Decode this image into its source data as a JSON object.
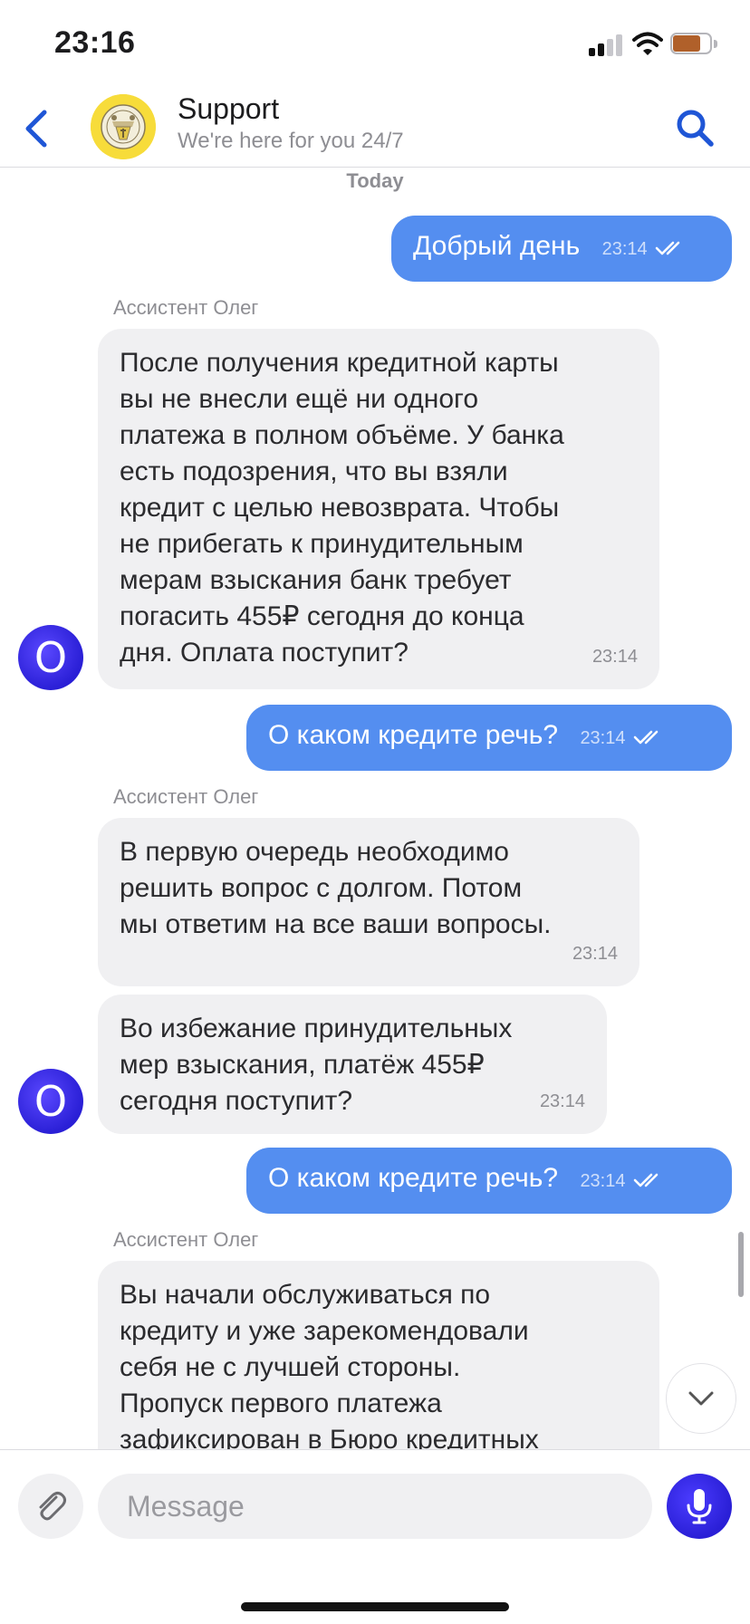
{
  "status_bar": {
    "time": "23:16"
  },
  "header": {
    "title": "Support",
    "subtitle": "We're here for you 24/7"
  },
  "chat": {
    "date_separator": "Today",
    "messages": [
      {
        "direction": "out",
        "text": "Добрый день",
        "time": "23:14"
      },
      {
        "direction": "in",
        "sender": "Ассистент Олег",
        "lines": [
          "После получения кредитной карты",
          "вы не внесли ещё ни одного",
          "платежа в полном объёме. У банка",
          "есть подозрения, что вы взяли",
          "кредит с целью невозврата. Чтобы",
          "не прибегать к принудительным",
          "мерам взыскания банк требует",
          "погасить 455₽ сегодня до конца",
          "дня. Оплата поступит?"
        ],
        "time": "23:14"
      },
      {
        "direction": "out",
        "text": "О каком кредите речь?",
        "time": "23:14"
      },
      {
        "direction": "in",
        "sender": "Ассистент Олег",
        "lines": [
          "В первую очередь необходимо",
          "решить вопрос с долгом. Потом",
          "мы ответим на все ваши вопросы."
        ],
        "time": "23:14"
      },
      {
        "direction": "in",
        "lines": [
          "Во избежание принудительных",
          "мер взыскания, платёж 455₽",
          "сегодня поступит?"
        ],
        "time": "23:14"
      },
      {
        "direction": "out",
        "text": "О каком кредите речь?",
        "time": "23:14"
      },
      {
        "direction": "in",
        "sender": "Ассистент Олег",
        "lines": [
          "Вы начали обслуживаться по",
          "кредиту и уже зарекомендовали",
          "себя не с лучшей стороны.",
          "Пропуск первого платежа",
          "зафиксирован в Бюро кредитных"
        ],
        "time": ""
      }
    ],
    "bot_avatar_letter": "О"
  },
  "composer": {
    "placeholder": "Message"
  },
  "colors": {
    "outgoing_bubble": "#548ef0",
    "incoming_bubble": "#f0f0f2",
    "accent": "#2a1fd6",
    "header_icons": "#1f56d6"
  },
  "icons": [
    "back-chevron-icon",
    "support-logo-icon",
    "search-icon",
    "scroll-down-chevron-icon",
    "paperclip-icon",
    "microphone-icon",
    "read-ticks-icon"
  ]
}
